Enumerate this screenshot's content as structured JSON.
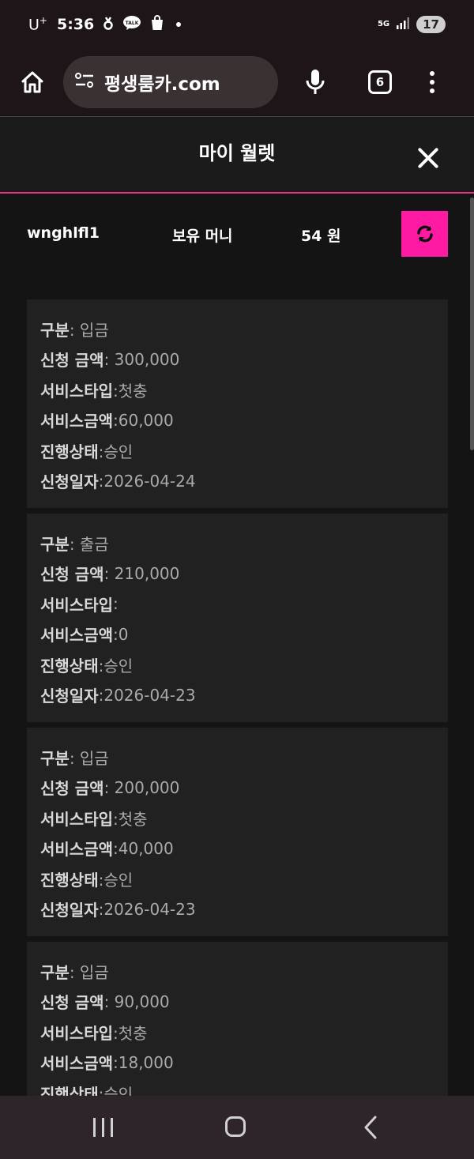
{
  "status_bar": {
    "carrier": "U",
    "carrier_sup": "+",
    "time": "5:36",
    "network": "5G",
    "battery": "17"
  },
  "browser": {
    "url": "평생룸카.com",
    "tab_count": "6"
  },
  "modal": {
    "title": "마이 월렛"
  },
  "wallet": {
    "username": "wnghlfl1",
    "money_label": "보유 머니",
    "money_value": "54 원"
  },
  "field_labels": {
    "type": "구분",
    "amount": "신청 금액",
    "service_type": "서비스타입",
    "service_amount": "서비스금액",
    "status": "진행상태",
    "date": "신청일자"
  },
  "transactions": [
    {
      "type": ": 입금",
      "amount": ": 300,000",
      "service_type": ":첫충",
      "service_amount": ":60,000",
      "status": ":승인",
      "date": ":2026-04-24"
    },
    {
      "type": ": 출금",
      "amount": ": 210,000",
      "service_type": ":",
      "service_amount": ":0",
      "status": ":승인",
      "date": ":2026-04-23"
    },
    {
      "type": ": 입금",
      "amount": ": 200,000",
      "service_type": ":첫충",
      "service_amount": ":40,000",
      "status": ":승인",
      "date": ":2026-04-23"
    },
    {
      "type": ": 입금",
      "amount": ": 90,000",
      "service_type": ":첫충",
      "service_amount": ":18,000",
      "status": ":승인",
      "date": ""
    }
  ],
  "icons": {
    "home": "home-icon",
    "site_settings": "tune-icon",
    "mic": "mic-icon",
    "tabs": "tabs-icon",
    "menu": "more-vert-icon",
    "close": "close-icon",
    "refresh": "refresh-icon"
  },
  "colors": {
    "accent": "#ff1aa3",
    "header_border": "#e6338a",
    "background": "#141414",
    "card": "#212121"
  }
}
